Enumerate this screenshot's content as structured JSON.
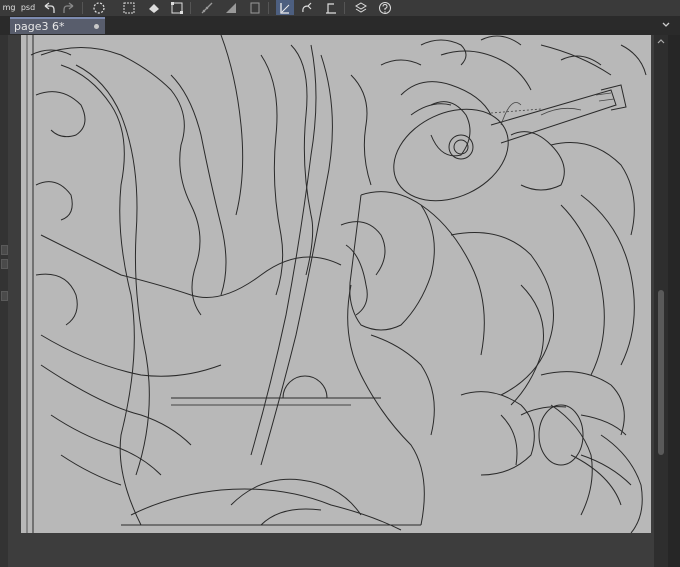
{
  "toolbar": {
    "buttons": [
      {
        "name": "open-icon",
        "label": "mg"
      },
      {
        "name": "export-psd-icon",
        "label": "psd"
      },
      {
        "name": "undo-icon"
      },
      {
        "name": "redo-icon"
      },
      {
        "name": "loading-spinner-icon"
      },
      {
        "name": "clear-icon"
      },
      {
        "name": "fill-icon"
      },
      {
        "name": "selection-icon"
      },
      {
        "name": "ruler-icon"
      },
      {
        "name": "gradient-icon"
      },
      {
        "name": "layer-icon"
      },
      {
        "name": "transform-icon"
      },
      {
        "name": "link-icon"
      },
      {
        "name": "align-icon"
      },
      {
        "name": "stack-icon"
      },
      {
        "name": "help-icon"
      }
    ]
  },
  "tab": {
    "title": "page3 6*"
  },
  "colors": {
    "accent": "#7d8bb0",
    "canvas_bg": "#b8b8b8",
    "workspace_bg": "#3d3d3d"
  }
}
